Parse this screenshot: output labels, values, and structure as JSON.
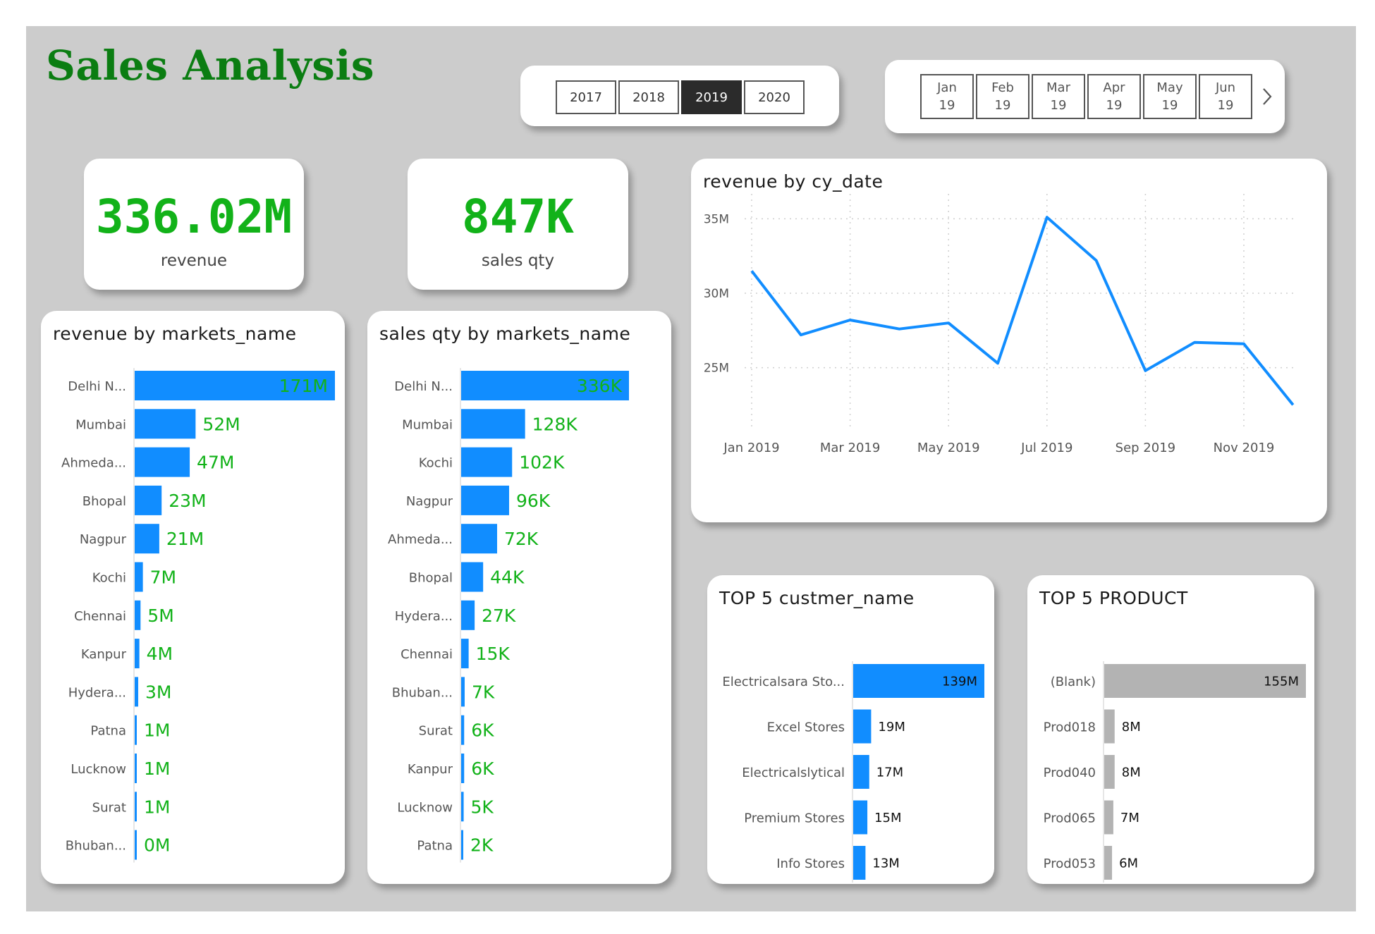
{
  "header": {
    "title": "Sales Analysis",
    "years": [
      "2017",
      "2018",
      "2019",
      "2020"
    ],
    "selected_year": "2019",
    "months": [
      [
        "Jan",
        "19"
      ],
      [
        "Feb",
        "19"
      ],
      [
        "Mar",
        "19"
      ],
      [
        "Apr",
        "19"
      ],
      [
        "May",
        "19"
      ],
      [
        "Jun",
        "19"
      ]
    ]
  },
  "kpis": {
    "revenue": {
      "value": "336.02M",
      "label": "revenue"
    },
    "sales_qty": {
      "value": "847K",
      "label": "sales qty"
    }
  },
  "colors": {
    "accent_blue": "#118dff",
    "kpi_green": "#12b219",
    "title_green": "#0b7d12",
    "bar_gray": "#b3b3b3"
  },
  "chart_data": [
    {
      "id": "revenue_by_market",
      "type": "bar",
      "orientation": "horizontal",
      "title": "revenue by markets_name",
      "categories": [
        "Delhi N...",
        "Mumbai",
        "Ahmeda...",
        "Bhopal",
        "Nagpur",
        "Kochi",
        "Chennai",
        "Kanpur",
        "Hydera...",
        "Patna",
        "Lucknow",
        "Surat",
        "Bhuban..."
      ],
      "values": [
        171,
        52,
        47,
        23,
        21,
        7,
        5,
        4,
        3,
        1,
        1,
        1,
        0
      ],
      "labels": [
        "171M",
        "52M",
        "47M",
        "23M",
        "21M",
        "7M",
        "5M",
        "4M",
        "3M",
        "1M",
        "1M",
        "1M",
        "0M"
      ],
      "max": 171
    },
    {
      "id": "qty_by_market",
      "type": "bar",
      "orientation": "horizontal",
      "title": "sales qty by markets_name",
      "categories": [
        "Delhi N...",
        "Mumbai",
        "Kochi",
        "Nagpur",
        "Ahmeda...",
        "Bhopal",
        "Hydera...",
        "Chennai",
        "Bhuban...",
        "Surat",
        "Kanpur",
        "Lucknow",
        "Patna"
      ],
      "values": [
        336,
        128,
        102,
        96,
        72,
        44,
        27,
        15,
        7,
        6,
        6,
        5,
        2
      ],
      "labels": [
        "336K",
        "128K",
        "102K",
        "96K",
        "72K",
        "44K",
        "27K",
        "15K",
        "7K",
        "6K",
        "6K",
        "5K",
        "2K"
      ],
      "max": 336
    },
    {
      "id": "revenue_by_date",
      "type": "line",
      "title": "revenue by cy_date",
      "x": [
        "2019-01",
        "2019-02",
        "2019-03",
        "2019-04",
        "2019-05",
        "2019-06",
        "2019-07",
        "2019-08",
        "2019-09",
        "2019-10",
        "2019-11",
        "2019-12"
      ],
      "values": [
        31.5,
        27.2,
        28.2,
        27.6,
        28.0,
        25.3,
        35.1,
        32.2,
        24.8,
        26.7,
        26.6,
        22.5
      ],
      "x_tick_labels": [
        "Jan 2019",
        "Mar 2019",
        "May 2019",
        "Jul 2019",
        "Sep 2019",
        "Nov 2019"
      ],
      "y_tick_labels": [
        "25M",
        "30M",
        "35M"
      ],
      "y_ticks": [
        25,
        30,
        35
      ],
      "ylim": [
        22,
        36.2
      ],
      "grid": true
    },
    {
      "id": "top5_customers",
      "type": "bar",
      "orientation": "horizontal",
      "title": "TOP 5 custmer_name",
      "categories": [
        "Electricalsara Sto...",
        "Excel Stores",
        "Electricalslytical",
        "Premium Stores",
        "Info Stores"
      ],
      "values": [
        139,
        19,
        17,
        15,
        13
      ],
      "labels": [
        "139M",
        "19M",
        "17M",
        "15M",
        "13M"
      ],
      "max": 139
    },
    {
      "id": "top5_products",
      "type": "bar",
      "orientation": "horizontal",
      "title": "TOP 5 PRODUCT",
      "categories": [
        "(Blank)",
        "Prod018",
        "Prod040",
        "Prod065",
        "Prod053"
      ],
      "values": [
        155,
        8,
        8,
        7,
        6
      ],
      "labels": [
        "155M",
        "8M",
        "8M",
        "7M",
        "6M"
      ],
      "max": 155
    }
  ]
}
